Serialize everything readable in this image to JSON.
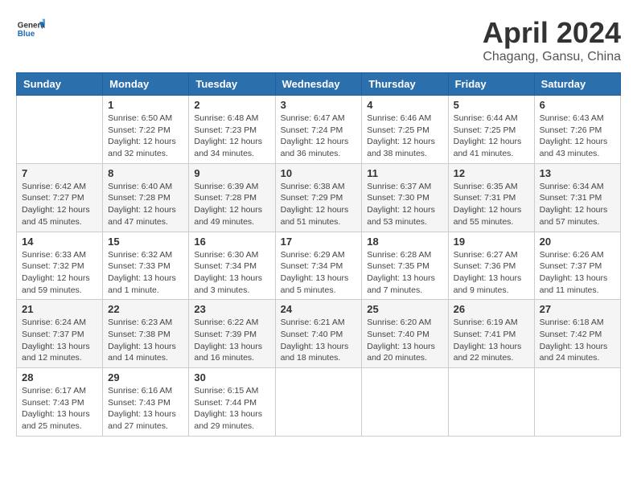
{
  "header": {
    "logo_general": "General",
    "logo_blue": "Blue",
    "month_title": "April 2024",
    "location": "Chagang, Gansu, China"
  },
  "weekdays": [
    "Sunday",
    "Monday",
    "Tuesday",
    "Wednesday",
    "Thursday",
    "Friday",
    "Saturday"
  ],
  "weeks": [
    [
      {
        "day": "",
        "info": ""
      },
      {
        "day": "1",
        "info": "Sunrise: 6:50 AM\nSunset: 7:22 PM\nDaylight: 12 hours\nand 32 minutes."
      },
      {
        "day": "2",
        "info": "Sunrise: 6:48 AM\nSunset: 7:23 PM\nDaylight: 12 hours\nand 34 minutes."
      },
      {
        "day": "3",
        "info": "Sunrise: 6:47 AM\nSunset: 7:24 PM\nDaylight: 12 hours\nand 36 minutes."
      },
      {
        "day": "4",
        "info": "Sunrise: 6:46 AM\nSunset: 7:25 PM\nDaylight: 12 hours\nand 38 minutes."
      },
      {
        "day": "5",
        "info": "Sunrise: 6:44 AM\nSunset: 7:25 PM\nDaylight: 12 hours\nand 41 minutes."
      },
      {
        "day": "6",
        "info": "Sunrise: 6:43 AM\nSunset: 7:26 PM\nDaylight: 12 hours\nand 43 minutes."
      }
    ],
    [
      {
        "day": "7",
        "info": "Sunrise: 6:42 AM\nSunset: 7:27 PM\nDaylight: 12 hours\nand 45 minutes."
      },
      {
        "day": "8",
        "info": "Sunrise: 6:40 AM\nSunset: 7:28 PM\nDaylight: 12 hours\nand 47 minutes."
      },
      {
        "day": "9",
        "info": "Sunrise: 6:39 AM\nSunset: 7:28 PM\nDaylight: 12 hours\nand 49 minutes."
      },
      {
        "day": "10",
        "info": "Sunrise: 6:38 AM\nSunset: 7:29 PM\nDaylight: 12 hours\nand 51 minutes."
      },
      {
        "day": "11",
        "info": "Sunrise: 6:37 AM\nSunset: 7:30 PM\nDaylight: 12 hours\nand 53 minutes."
      },
      {
        "day": "12",
        "info": "Sunrise: 6:35 AM\nSunset: 7:31 PM\nDaylight: 12 hours\nand 55 minutes."
      },
      {
        "day": "13",
        "info": "Sunrise: 6:34 AM\nSunset: 7:31 PM\nDaylight: 12 hours\nand 57 minutes."
      }
    ],
    [
      {
        "day": "14",
        "info": "Sunrise: 6:33 AM\nSunset: 7:32 PM\nDaylight: 12 hours\nand 59 minutes."
      },
      {
        "day": "15",
        "info": "Sunrise: 6:32 AM\nSunset: 7:33 PM\nDaylight: 13 hours\nand 1 minute."
      },
      {
        "day": "16",
        "info": "Sunrise: 6:30 AM\nSunset: 7:34 PM\nDaylight: 13 hours\nand 3 minutes."
      },
      {
        "day": "17",
        "info": "Sunrise: 6:29 AM\nSunset: 7:34 PM\nDaylight: 13 hours\nand 5 minutes."
      },
      {
        "day": "18",
        "info": "Sunrise: 6:28 AM\nSunset: 7:35 PM\nDaylight: 13 hours\nand 7 minutes."
      },
      {
        "day": "19",
        "info": "Sunrise: 6:27 AM\nSunset: 7:36 PM\nDaylight: 13 hours\nand 9 minutes."
      },
      {
        "day": "20",
        "info": "Sunrise: 6:26 AM\nSunset: 7:37 PM\nDaylight: 13 hours\nand 11 minutes."
      }
    ],
    [
      {
        "day": "21",
        "info": "Sunrise: 6:24 AM\nSunset: 7:37 PM\nDaylight: 13 hours\nand 12 minutes."
      },
      {
        "day": "22",
        "info": "Sunrise: 6:23 AM\nSunset: 7:38 PM\nDaylight: 13 hours\nand 14 minutes."
      },
      {
        "day": "23",
        "info": "Sunrise: 6:22 AM\nSunset: 7:39 PM\nDaylight: 13 hours\nand 16 minutes."
      },
      {
        "day": "24",
        "info": "Sunrise: 6:21 AM\nSunset: 7:40 PM\nDaylight: 13 hours\nand 18 minutes."
      },
      {
        "day": "25",
        "info": "Sunrise: 6:20 AM\nSunset: 7:40 PM\nDaylight: 13 hours\nand 20 minutes."
      },
      {
        "day": "26",
        "info": "Sunrise: 6:19 AM\nSunset: 7:41 PM\nDaylight: 13 hours\nand 22 minutes."
      },
      {
        "day": "27",
        "info": "Sunrise: 6:18 AM\nSunset: 7:42 PM\nDaylight: 13 hours\nand 24 minutes."
      }
    ],
    [
      {
        "day": "28",
        "info": "Sunrise: 6:17 AM\nSunset: 7:43 PM\nDaylight: 13 hours\nand 25 minutes."
      },
      {
        "day": "29",
        "info": "Sunrise: 6:16 AM\nSunset: 7:43 PM\nDaylight: 13 hours\nand 27 minutes."
      },
      {
        "day": "30",
        "info": "Sunrise: 6:15 AM\nSunset: 7:44 PM\nDaylight: 13 hours\nand 29 minutes."
      },
      {
        "day": "",
        "info": ""
      },
      {
        "day": "",
        "info": ""
      },
      {
        "day": "",
        "info": ""
      },
      {
        "day": "",
        "info": ""
      }
    ]
  ]
}
